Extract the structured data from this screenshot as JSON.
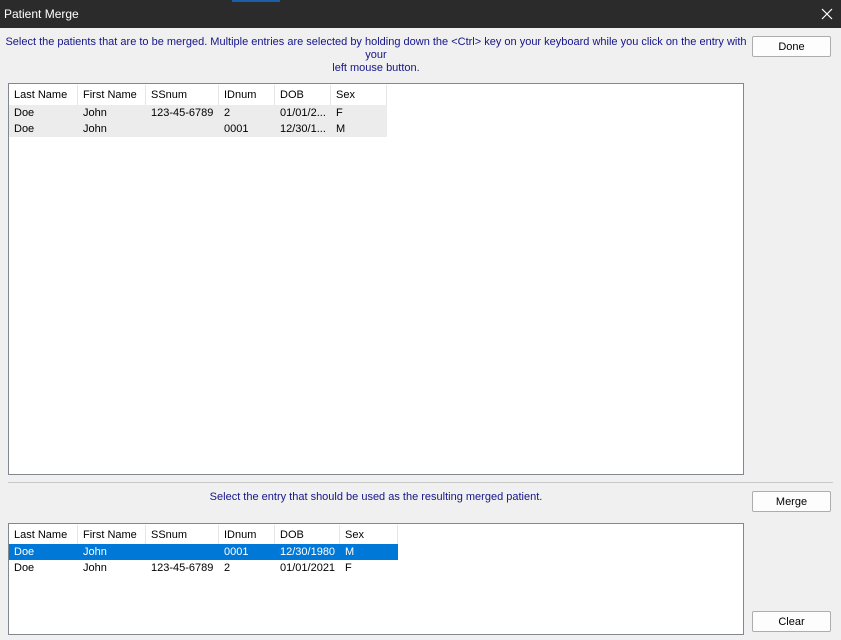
{
  "window": {
    "title": "Patient Merge"
  },
  "instructions": {
    "select_line1": "Select the patients that are to be merged.  Multiple entries are selected by holding down the <Ctrl> key on your keyboard while you click on the entry with your",
    "select_line2": "left mouse button.",
    "result": "Select the entry that should be used as the resulting merged patient."
  },
  "buttons": {
    "done": "Done",
    "merge": "Merge",
    "clear": "Clear"
  },
  "columns": [
    "Last Name",
    "First Name",
    "SSnum",
    "IDnum",
    "DOB",
    "Sex"
  ],
  "top_list": {
    "rows": [
      {
        "last": "Doe",
        "first": "John",
        "ssn": "123-45-6789",
        "id": "2",
        "dob": "01/01/2...",
        "sex": "F"
      },
      {
        "last": "Doe",
        "first": "John",
        "ssn": "",
        "id": "0001",
        "dob": "12/30/1...",
        "sex": "M"
      }
    ]
  },
  "bottom_list": {
    "rows": [
      {
        "last": "Doe",
        "first": "John",
        "ssn": "",
        "id": "0001",
        "dob": "12/30/1980",
        "sex": "M",
        "selected": true
      },
      {
        "last": "Doe",
        "first": "John",
        "ssn": "123-45-6789",
        "id": "2",
        "dob": "01/01/2021",
        "sex": "F",
        "selected": false
      }
    ]
  }
}
